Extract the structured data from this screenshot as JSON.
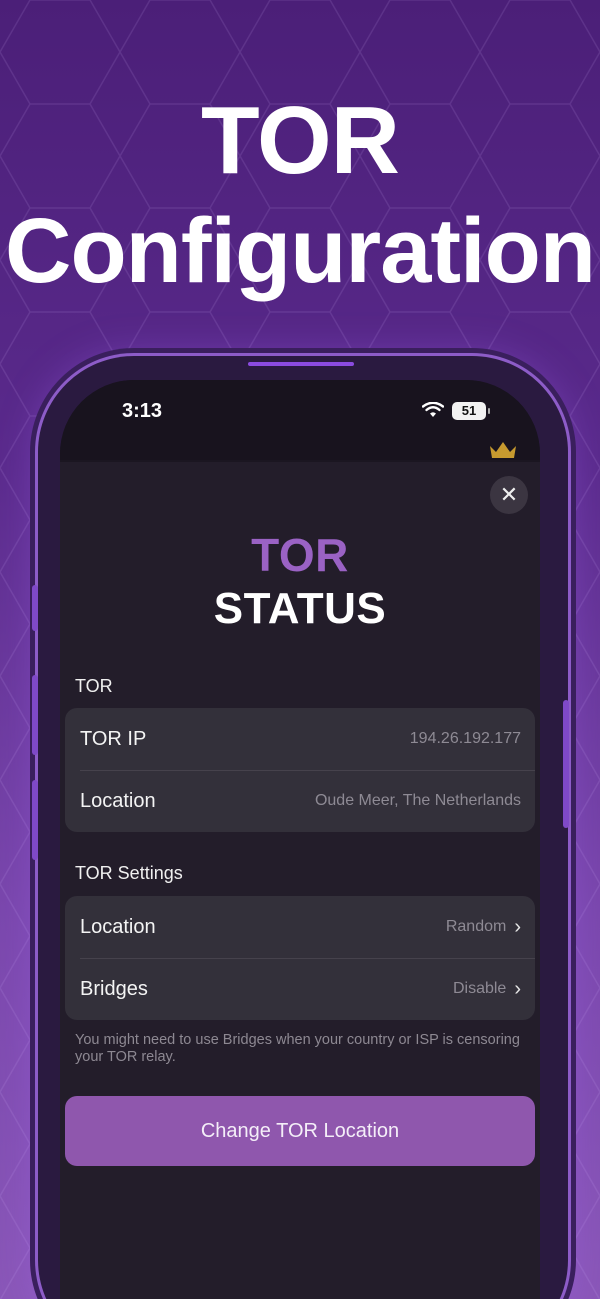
{
  "hero": {
    "line1": "TOR",
    "line2": "Configuration"
  },
  "status_bar": {
    "time": "3:13",
    "battery": "51"
  },
  "sheet": {
    "title_line1": "TOR",
    "title_line2": "STATUS",
    "close_icon": "close-icon",
    "section_tor": {
      "label": "TOR",
      "rows": [
        {
          "label": "TOR IP",
          "value": "194.26.192.177"
        },
        {
          "label": "Location",
          "value": "Oude Meer, The Netherlands"
        }
      ]
    },
    "section_settings": {
      "label": "TOR Settings",
      "rows": [
        {
          "label": "Location",
          "value": "Random"
        },
        {
          "label": "Bridges",
          "value": "Disable"
        }
      ]
    },
    "note": "You might need to use Bridges when your country or ISP is censoring your TOR relay.",
    "cta_label": "Change TOR Location"
  },
  "colors": {
    "accent": "#9a62c4",
    "button": "#8f57ad",
    "sheet_bg": "#231d2a",
    "card_bg": "#33303a"
  }
}
